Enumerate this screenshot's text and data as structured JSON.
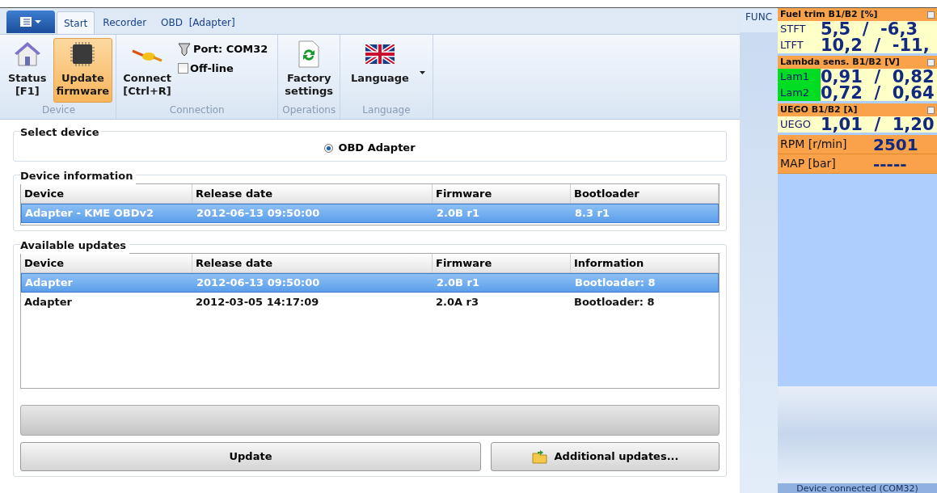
{
  "tabs": [
    {
      "label": "Start",
      "selected": true
    },
    {
      "label": "Recorder",
      "selected": false
    },
    {
      "label": "OBD  [Adapter]",
      "selected": false
    }
  ],
  "ribbon": [
    {
      "label": "Device",
      "buttons": [
        {
          "label": "Status\n[F1]",
          "selected": false
        },
        {
          "label": "Update\nfirmware",
          "selected": true
        }
      ]
    },
    {
      "label": "Connection",
      "buttons": [
        {
          "label": "Connect\n[Ctrl+R]",
          "selected": false
        }
      ],
      "port": "Port: COM32",
      "offline": {
        "label": "Off-line",
        "checked": false
      }
    },
    {
      "label": "Operations",
      "buttons": [
        {
          "label": "Factory\nsettings",
          "selected": false
        }
      ]
    },
    {
      "label": "Language",
      "buttons": [
        {
          "label": "Language",
          "selected": false
        }
      ]
    }
  ],
  "select_device": {
    "title": "Select device",
    "option": {
      "label": "OBD Adapter",
      "selected": true
    }
  },
  "device_information": {
    "title": "Device information",
    "columns": [
      "Device",
      "Release date",
      "Firmware",
      "Bootloader"
    ],
    "rows": [
      {
        "cells": [
          "Adapter - KME OBDv2",
          "2012-06-13 09:50:00",
          "2.0B r1",
          "8.3 r1"
        ],
        "selected": true
      }
    ]
  },
  "available_updates": {
    "title": "Available updates",
    "columns": [
      "Device",
      "Release date",
      "Firmware",
      "Information"
    ],
    "rows": [
      {
        "cells": [
          "Adapter",
          "2012-06-13 09:50:00",
          "2.0B r1",
          "Bootloader: 8"
        ],
        "selected": true
      },
      {
        "cells": [
          "Adapter",
          "2012-03-05 14:17:09",
          "2.0A r3",
          "Bootloader: 8"
        ],
        "selected": false
      }
    ]
  },
  "progress": {
    "level": 0
  },
  "buttons": [
    "Update",
    "Additional updates..."
  ],
  "func_label": "FUNC",
  "gauges": [
    {
      "kind": "group",
      "title": "Fuel trim B1/B2 [%]",
      "rows": [
        {
          "label": "STFT",
          "value": "5,5  /  -6,3"
        },
        {
          "label": "LTFT",
          "value": "10,2  /  -11,"
        }
      ]
    },
    {
      "kind": "group",
      "title": "Lambda sens. B1/B2 [V]",
      "rows": [
        {
          "label": "Lam1",
          "value": "0,91  /  0,82",
          "color": "#00dd22"
        },
        {
          "label": "Lam2",
          "value": "0,72  /  0,64",
          "color": "#00dd22"
        }
      ]
    },
    {
      "kind": "group",
      "title": "UEGO B1/B2 [λ]",
      "rows": [
        {
          "label": "UEGO",
          "value": "1,01  /  1,20"
        }
      ]
    },
    {
      "kind": "single",
      "label": "RPM [r/min]",
      "value": "2501"
    },
    {
      "kind": "single",
      "label": "MAP [bar]",
      "value": "-----"
    }
  ],
  "status_bar": "Device connected (COM32)"
}
